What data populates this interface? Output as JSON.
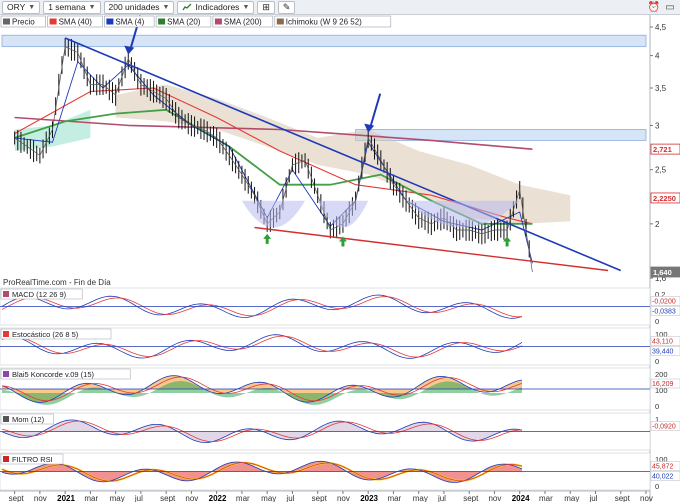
{
  "toolbar": {
    "ticker": "ORY",
    "timeframe": "1 semana",
    "units": "200 unidades",
    "indicators_label": "Indicadores"
  },
  "legend": [
    {
      "label": "Precio",
      "color": "#666666"
    },
    {
      "label": "SMA (40)",
      "color": "#e53935"
    },
    {
      "label": "SMA (4)",
      "color": "#1e3ab8"
    },
    {
      "label": "SMA (20)",
      "color": "#2e7d32"
    },
    {
      "label": "SMA (200)",
      "color": "#b24b6c"
    },
    {
      "label": "Ichimoku (W 9 26 52)",
      "color": "#8b6b4a"
    }
  ],
  "colors": {
    "trendline": "#1e3ab8",
    "support": "#d32f2f",
    "panel_line": "#1e3ab8"
  },
  "price_axis": [
    "4,5",
    "4",
    "3,5",
    "3",
    "2,5",
    "2",
    "1,6"
  ],
  "price_badges": [
    {
      "text": "2,721",
      "color": "#d32f2f",
      "fg": "#d32f2f"
    },
    {
      "text": "2,2250",
      "color": "#d32f2f",
      "fg": "#d32f2f"
    },
    {
      "text": "1,640",
      "color": "#777777",
      "fg": "#ffffff"
    }
  ],
  "source_note": "ProRealTime.com - Fin de Día",
  "panels": [
    {
      "name": "macd",
      "title": "MACD (12 26 9)",
      "axis": [
        "0,2",
        "0"
      ],
      "badges": [
        "-0,0200",
        "-0,0383"
      ]
    },
    {
      "name": "stoch",
      "title": "Estocástico (26 8 5)",
      "axis": [
        "100",
        "0"
      ],
      "badges": [
        "43,110",
        "39,440"
      ]
    },
    {
      "name": "konc",
      "title": "Blai5 Koncorde v.09 (15)",
      "axis": [
        "200",
        "100",
        "0"
      ],
      "badges": [
        "16,209"
      ]
    },
    {
      "name": "mom",
      "title": "Mom (12)",
      "axis": [
        "1"
      ],
      "badges": [
        "-0,0920"
      ]
    },
    {
      "name": "rsi",
      "title": "FILTRO RSI",
      "axis": [
        "100",
        "0"
      ],
      "badges": [
        "45,872",
        "40,022"
      ]
    }
  ],
  "time_axis": [
    {
      "label": "sept",
      "bold": false
    },
    {
      "label": "nov",
      "bold": false
    },
    {
      "label": "2021",
      "bold": true
    },
    {
      "label": "mar",
      "bold": false
    },
    {
      "label": "may",
      "bold": false
    },
    {
      "label": "jul",
      "bold": false
    },
    {
      "label": "sept",
      "bold": false
    },
    {
      "label": "nov",
      "bold": false
    },
    {
      "label": "2022",
      "bold": true
    },
    {
      "label": "mar",
      "bold": false
    },
    {
      "label": "may",
      "bold": false
    },
    {
      "label": "jul",
      "bold": false
    },
    {
      "label": "sept",
      "bold": false
    },
    {
      "label": "nov",
      "bold": false
    },
    {
      "label": "2023",
      "bold": true
    },
    {
      "label": "mar",
      "bold": false
    },
    {
      "label": "may",
      "bold": false
    },
    {
      "label": "jul",
      "bold": false
    },
    {
      "label": "sept",
      "bold": false
    },
    {
      "label": "nov",
      "bold": false
    },
    {
      "label": "2024",
      "bold": true
    },
    {
      "label": "mar",
      "bold": false
    },
    {
      "label": "may",
      "bold": false
    },
    {
      "label": "jul",
      "bold": false
    },
    {
      "label": "sept",
      "bold": false
    },
    {
      "label": "nov",
      "bold": false
    }
  ],
  "chart_data": {
    "type": "line",
    "ticker": "ORY",
    "ylim": [
      1.6,
      4.5
    ],
    "x_start": "2020-08",
    "x_end": "2024-11",
    "price_weekly_close_approx": [
      {
        "date": "2020-09",
        "y": 2.85
      },
      {
        "date": "2020-10",
        "y": 2.75
      },
      {
        "date": "2020-11",
        "y": 2.65
      },
      {
        "date": "2020-12",
        "y": 2.95
      },
      {
        "date": "2021-01",
        "y": 4.15
      },
      {
        "date": "2021-02",
        "y": 4.05
      },
      {
        "date": "2021-03",
        "y": 3.55
      },
      {
        "date": "2021-04",
        "y": 3.55
      },
      {
        "date": "2021-05",
        "y": 3.4
      },
      {
        "date": "2021-06",
        "y": 3.95
      },
      {
        "date": "2021-07",
        "y": 3.55
      },
      {
        "date": "2021-08",
        "y": 3.45
      },
      {
        "date": "2021-09",
        "y": 3.35
      },
      {
        "date": "2021-10",
        "y": 3.1
      },
      {
        "date": "2021-11",
        "y": 3.0
      },
      {
        "date": "2021-12",
        "y": 2.95
      },
      {
        "date": "2022-01",
        "y": 2.85
      },
      {
        "date": "2022-02",
        "y": 2.65
      },
      {
        "date": "2022-03",
        "y": 2.45
      },
      {
        "date": "2022-04",
        "y": 2.25
      },
      {
        "date": "2022-05",
        "y": 2.0
      },
      {
        "date": "2022-06",
        "y": 2.1
      },
      {
        "date": "2022-07",
        "y": 2.55
      },
      {
        "date": "2022-08",
        "y": 2.6
      },
      {
        "date": "2022-09",
        "y": 2.25
      },
      {
        "date": "2022-10",
        "y": 1.95
      },
      {
        "date": "2022-11",
        "y": 2.0
      },
      {
        "date": "2022-12",
        "y": 2.2
      },
      {
        "date": "2023-01",
        "y": 2.85
      },
      {
        "date": "2023-02",
        "y": 2.6
      },
      {
        "date": "2023-03",
        "y": 2.35
      },
      {
        "date": "2023-04",
        "y": 2.2
      },
      {
        "date": "2023-05",
        "y": 2.05
      },
      {
        "date": "2023-06",
        "y": 2.0
      },
      {
        "date": "2023-07",
        "y": 2.05
      },
      {
        "date": "2023-08",
        "y": 1.95
      },
      {
        "date": "2023-09",
        "y": 1.95
      },
      {
        "date": "2023-10",
        "y": 1.92
      },
      {
        "date": "2023-11",
        "y": 1.95
      },
      {
        "date": "2023-12",
        "y": 1.95
      },
      {
        "date": "2024-01",
        "y": 2.3
      },
      {
        "date": "2024-02",
        "y": 1.64
      }
    ],
    "sma200": [
      {
        "date": "2020-09",
        "y": 3.1
      },
      {
        "date": "2021-06",
        "y": 3.0
      },
      {
        "date": "2022-06",
        "y": 2.95
      },
      {
        "date": "2023-06",
        "y": 2.82
      },
      {
        "date": "2024-02",
        "y": 2.72
      }
    ],
    "sma40": [
      {
        "date": "2020-09",
        "y": 2.9
      },
      {
        "date": "2021-03",
        "y": 3.45
      },
      {
        "date": "2021-08",
        "y": 3.5
      },
      {
        "date": "2022-01",
        "y": 3.1
      },
      {
        "date": "2022-06",
        "y": 2.7
      },
      {
        "date": "2022-12",
        "y": 2.35
      },
      {
        "date": "2023-06",
        "y": 2.25
      },
      {
        "date": "2023-12",
        "y": 2.05
      },
      {
        "date": "2024-02",
        "y": 2.0
      }
    ],
    "sma20": [
      {
        "date": "2020-09",
        "y": 2.85
      },
      {
        "date": "2021-01",
        "y": 3.05
      },
      {
        "date": "2021-05",
        "y": 3.15
      },
      {
        "date": "2021-09",
        "y": 3.2
      },
      {
        "date": "2022-02",
        "y": 2.75
      },
      {
        "date": "2022-06",
        "y": 2.35
      },
      {
        "date": "2022-10",
        "y": 2.35
      },
      {
        "date": "2023-02",
        "y": 2.45
      },
      {
        "date": "2023-06",
        "y": 2.2
      },
      {
        "date": "2023-10",
        "y": 2.0
      },
      {
        "date": "2024-02",
        "y": 2.0
      }
    ],
    "sma4": [
      {
        "date": "2020-09",
        "y": 2.85
      },
      {
        "date": "2020-12",
        "y": 2.8
      },
      {
        "date": "2021-02",
        "y": 3.9
      },
      {
        "date": "2021-04",
        "y": 3.5
      },
      {
        "date": "2021-06",
        "y": 3.85
      },
      {
        "date": "2021-08",
        "y": 3.4
      },
      {
        "date": "2021-11",
        "y": 3.0
      },
      {
        "date": "2022-02",
        "y": 2.75
      },
      {
        "date": "2022-05",
        "y": 2.05
      },
      {
        "date": "2022-07",
        "y": 2.5
      },
      {
        "date": "2022-10",
        "y": 1.98
      },
      {
        "date": "2022-12",
        "y": 2.2
      },
      {
        "date": "2023-01",
        "y": 2.8
      },
      {
        "date": "2023-04",
        "y": 2.2
      },
      {
        "date": "2023-07",
        "y": 2.02
      },
      {
        "date": "2023-10",
        "y": 1.95
      },
      {
        "date": "2024-01",
        "y": 2.1
      },
      {
        "date": "2024-02",
        "y": 1.7
      }
    ],
    "trendline_down": [
      {
        "date": "2021-01",
        "y": 4.3
      },
      {
        "date": "2024-09",
        "y": 1.65
      }
    ],
    "trendline_support": [
      {
        "date": "2022-04",
        "y": 1.97
      },
      {
        "date": "2024-08",
        "y": 1.65
      }
    ],
    "resistance_zones": [
      {
        "from": "2020-08",
        "to": "2024-11",
        "low": 4.15,
        "high": 4.35
      },
      {
        "from": "2022-12",
        "to": "2024-11",
        "low": 2.82,
        "high": 2.95
      }
    ],
    "annotations": [
      "3 green up arrows at 2022 and 2023 lows",
      "3 blue arrows at the main highs"
    ]
  }
}
